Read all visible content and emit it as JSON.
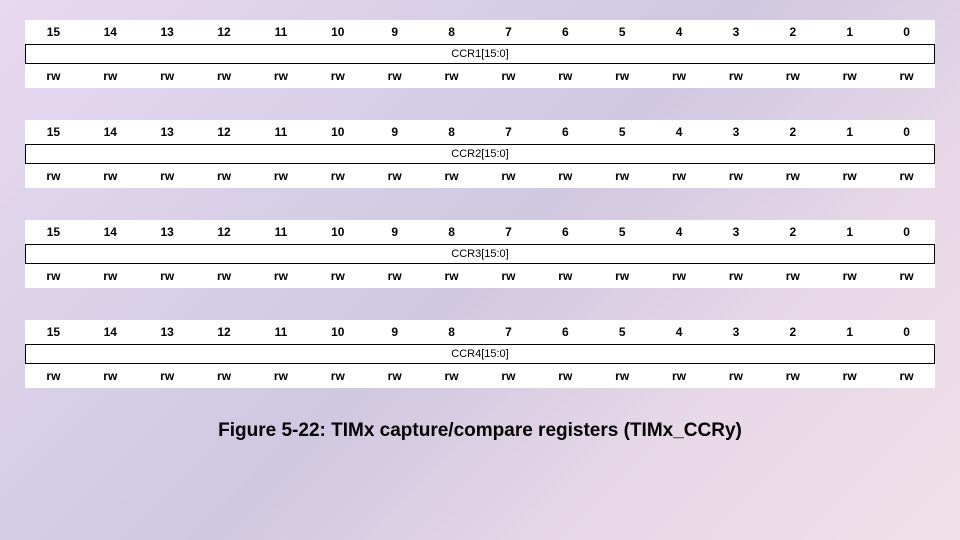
{
  "bits": [
    "15",
    "14",
    "13",
    "12",
    "11",
    "10",
    "9",
    "8",
    "7",
    "6",
    "5",
    "4",
    "3",
    "2",
    "1",
    "0"
  ],
  "rw": [
    "rw",
    "rw",
    "rw",
    "rw",
    "rw",
    "rw",
    "rw",
    "rw",
    "rw",
    "rw",
    "rw",
    "rw",
    "rw",
    "rw",
    "rw",
    "rw"
  ],
  "registers": [
    {
      "field": "CCR1[15:0]"
    },
    {
      "field": "CCR2[15:0]"
    },
    {
      "field": "CCR3[15:0]"
    },
    {
      "field": "CCR4[15:0]"
    }
  ],
  "caption": "Figure 5-22: TIMx capture/compare registers (TIMx_CCRy)"
}
